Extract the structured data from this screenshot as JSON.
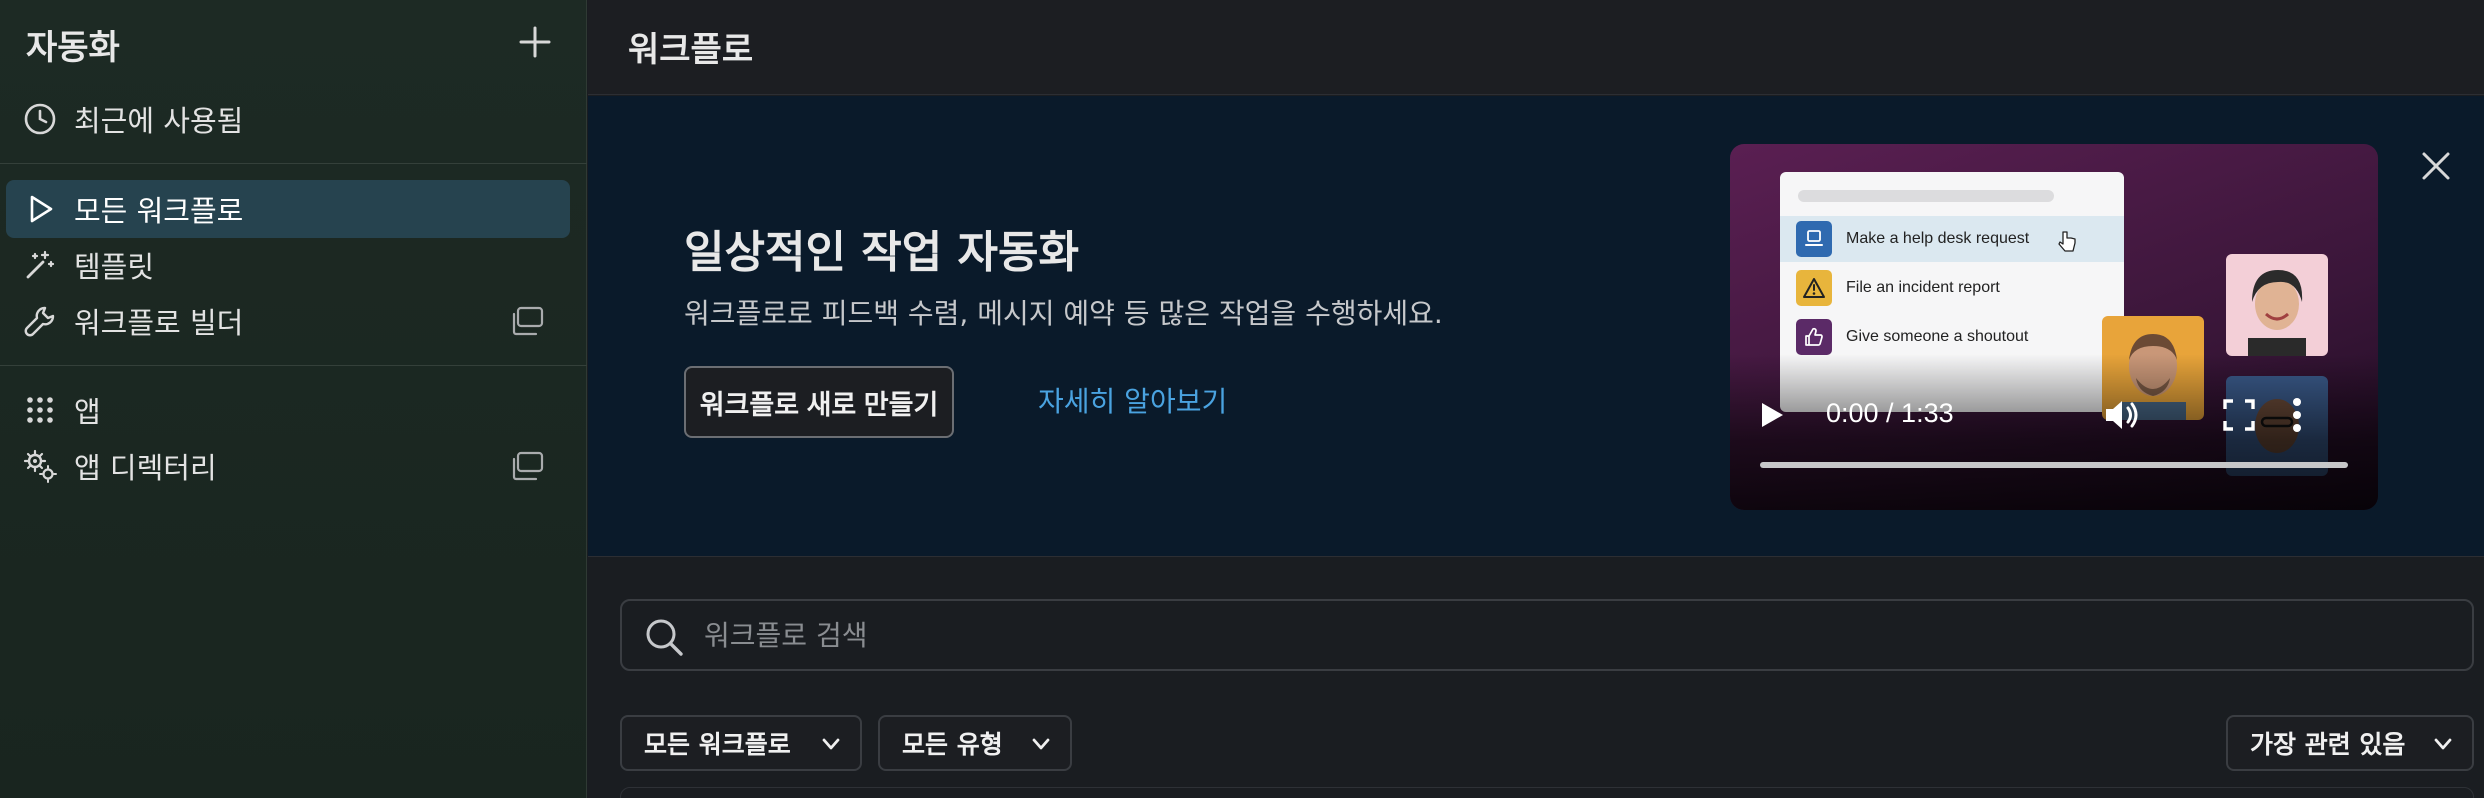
{
  "sidebar": {
    "title": "자동화",
    "recent": "최근에 사용됨",
    "items": [
      {
        "label": "모든 워크플로"
      },
      {
        "label": "템플릿"
      },
      {
        "label": "워크플로 빌더"
      },
      {
        "label": "앱"
      },
      {
        "label": "앱 디렉터리"
      }
    ]
  },
  "header": {
    "title": "워크플로"
  },
  "banner": {
    "title": "일상적인 작업 자동화",
    "description": "워크플로로 피드백 수렴, 메시지 예약 등 많은 작업을 수행하세요.",
    "create_button": "워크플로 새로 만들기",
    "learn_more": "자세히 알아보기",
    "video": {
      "menu_items": [
        "Make a help desk request",
        "File an incident report",
        "Give someone a shoutout"
      ],
      "time": "0:00 / 1:33",
      "progress": 0
    }
  },
  "search": {
    "placeholder": "워크플로 검색"
  },
  "filters": {
    "workflows": "모든 워크플로",
    "types": "모든 유형",
    "sort": "가장 관련 있음"
  },
  "colors": {
    "sidebar_bg": "#1d2a24",
    "active_item": "#26434f",
    "banner_bg": "#0a1a2a",
    "link": "#4aa3e0",
    "video_bg": "#5a1f52"
  }
}
